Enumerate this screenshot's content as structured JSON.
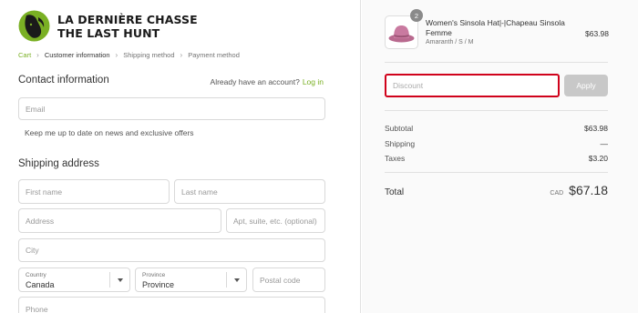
{
  "brand": {
    "line1": "LA DERNIÈRE CHASSE",
    "line2": "THE LAST HUNT"
  },
  "breadcrumb": [
    {
      "label": "Cart",
      "state": "link"
    },
    {
      "label": "Customer information",
      "state": "current"
    },
    {
      "label": "Shipping method",
      "state": "inactive"
    },
    {
      "label": "Payment method",
      "state": "inactive"
    }
  ],
  "contact": {
    "title": "Contact information",
    "account_prompt": "Already have an account?",
    "login_link": "Log in",
    "email_placeholder": "Email",
    "optin_text": "Keep me up to date on news and exclusive offers"
  },
  "shipping": {
    "title": "Shipping address",
    "first_name_placeholder": "First name",
    "last_name_placeholder": "Last name",
    "address_placeholder": "Address",
    "apt_placeholder": "Apt, suite, etc. (optional)",
    "city_placeholder": "City",
    "country_label": "Country",
    "country_value": "Canada",
    "province_label": "Province",
    "province_value": "Province",
    "postal_placeholder": "Postal code",
    "phone_placeholder": "Phone"
  },
  "order": {
    "product": {
      "name": "Women's Sinsola Hat|-|Chapeau Sinsola Femme",
      "variant": "Amaranth / S / M",
      "price": "$63.98",
      "quantity": "2"
    },
    "discount_placeholder": "Discount",
    "apply_label": "Apply",
    "subtotal_label": "Subtotal",
    "subtotal_value": "$63.98",
    "shipping_label": "Shipping",
    "shipping_value": "—",
    "taxes_label": "Taxes",
    "taxes_value": "$3.20",
    "total_label": "Total",
    "currency": "CAD",
    "total_value": "$67.18"
  },
  "colors": {
    "accent": "#7ab024",
    "error_border": "#d0021b",
    "button_disabled": "#c8c8c8"
  },
  "icons": {
    "logo": "deer-head-logo",
    "breadcrumb_separator": "chevron-right-icon",
    "select_caret": "caret-down-icon",
    "product_image": "hat-thumbnail"
  }
}
